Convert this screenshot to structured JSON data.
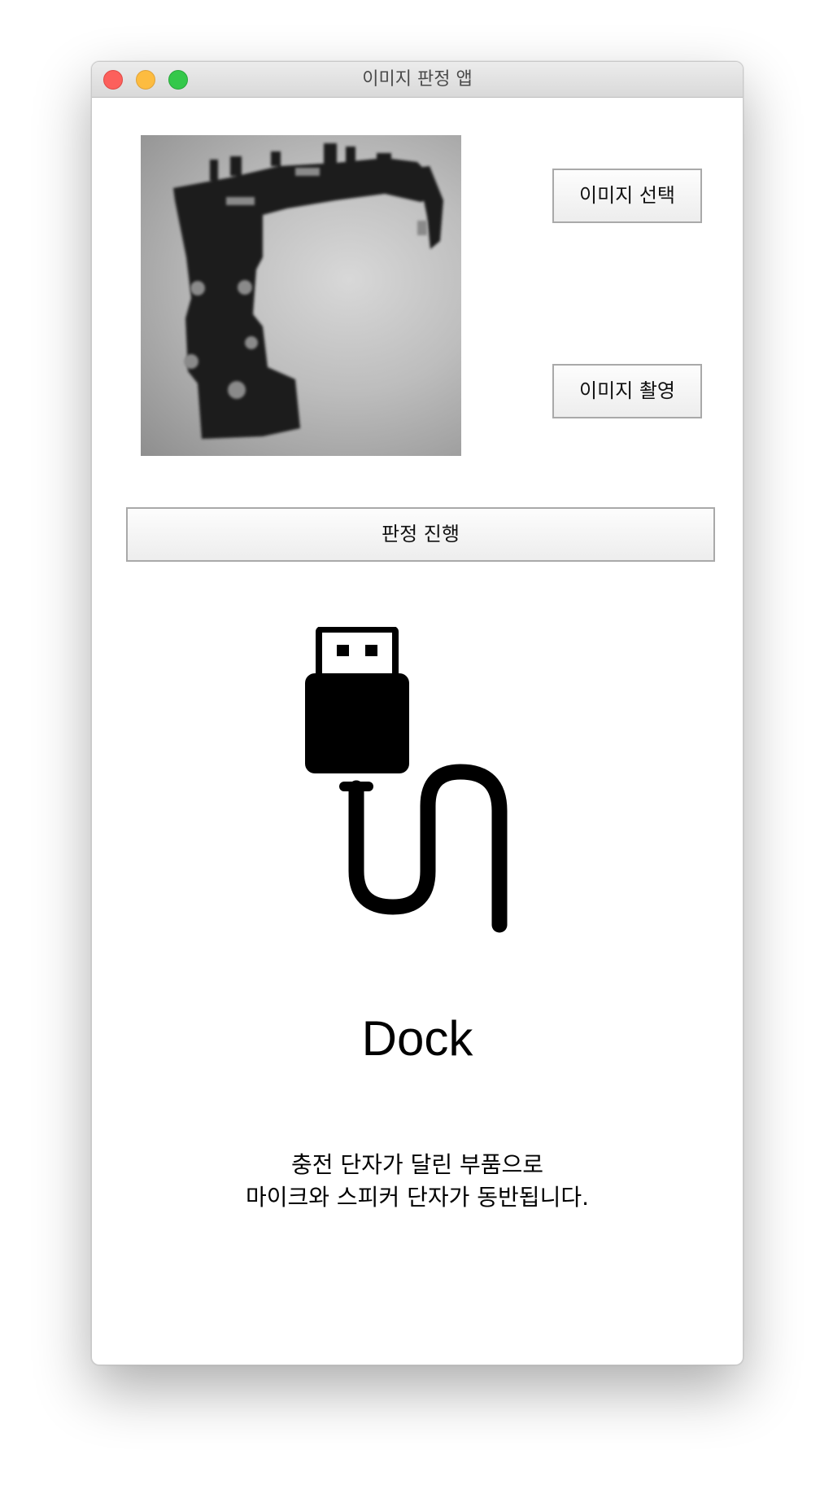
{
  "window": {
    "title": "이미지 판정 앱"
  },
  "image_panel": {
    "subject": "charging dock part photo"
  },
  "buttons": {
    "select_image": "이미지 선택",
    "capture_image": "이미지 촬영",
    "judge": "판정 진행"
  },
  "result": {
    "icon": "usb-cable-icon",
    "label": "Dock",
    "description_line1": "충전 단자가 달린 부품으로",
    "description_line2": "마이크와 스피커 단자가 동반됩니다."
  },
  "colors": {
    "close": "#fc605c",
    "minimize": "#fdbc40",
    "maximize": "#34c84a"
  }
}
